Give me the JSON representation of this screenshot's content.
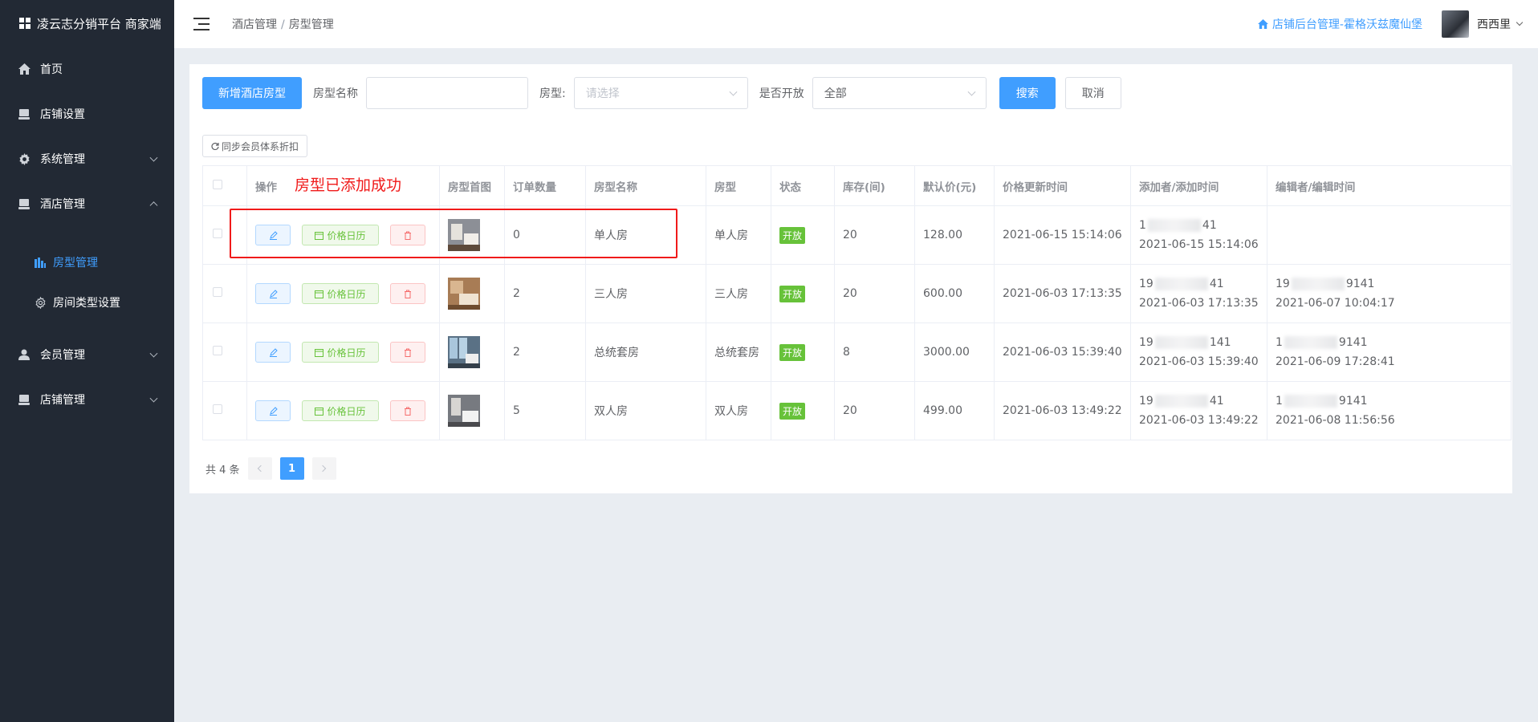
{
  "app": {
    "brand": "凌云志分销平台 商家端"
  },
  "sidebar": {
    "items": [
      {
        "label": "首页",
        "icon": "home-icon"
      },
      {
        "label": "店铺设置",
        "icon": "monitor-icon"
      },
      {
        "label": "系统管理",
        "icon": "gear-icon"
      },
      {
        "label": "酒店管理",
        "icon": "monitor-icon"
      },
      {
        "label": "会员管理",
        "icon": "user-icon"
      },
      {
        "label": "店铺管理",
        "icon": "monitor-icon"
      }
    ],
    "hotel_sub": [
      {
        "label": "房型管理",
        "icon": "bar-chart-icon",
        "active": true
      },
      {
        "label": "房间类型设置",
        "icon": "cog-icon"
      }
    ]
  },
  "header": {
    "breadcrumb": [
      "酒店管理",
      "房型管理"
    ],
    "breadcrumb_sep": "/",
    "store_link": "店铺后台管理-霍格沃兹魔仙堡",
    "username": "西西里"
  },
  "toolbar": {
    "add_label": "新增酒店房型",
    "room_name_label": "房型名称",
    "room_name_value": "",
    "room_type_label": "房型:",
    "room_type_placeholder": "请选择",
    "open_label": "是否开放",
    "open_value": "全部",
    "search_label": "搜索",
    "cancel_label": "取消",
    "sync_label": "同步会员体系折扣"
  },
  "table": {
    "headers": [
      "操作",
      "房型首图",
      "订单数量",
      "房型名称",
      "房型",
      "状态",
      "库存(间)",
      "默认价(元)",
      "价格更新时间",
      "添加者/添加时间",
      "编辑者/编辑时间"
    ],
    "price_calendar_label": "价格日历",
    "rows": [
      {
        "orders": "0",
        "name": "单人房",
        "type": "单人房",
        "status": "开放",
        "stock": "20",
        "price": "128.00",
        "updated": "2021-06-15 15:14:06",
        "adder_prefix": "1",
        "adder_suffix": "41",
        "added": "2021-06-15 15:14:06",
        "editor_prefix": "",
        "editor_suffix": "",
        "edited": ""
      },
      {
        "orders": "2",
        "name": "三人房",
        "type": "三人房",
        "status": "开放",
        "stock": "20",
        "price": "600.00",
        "updated": "2021-06-03 17:13:35",
        "adder_prefix": "19",
        "adder_suffix": "41",
        "added": "2021-06-03 17:13:35",
        "editor_prefix": "19",
        "editor_suffix": "9141",
        "edited": "2021-06-07 10:04:17"
      },
      {
        "orders": "2",
        "name": "总统套房",
        "type": "总统套房",
        "status": "开放",
        "stock": "8",
        "price": "3000.00",
        "updated": "2021-06-03 15:39:40",
        "adder_prefix": "19",
        "adder_suffix": "141",
        "added": "2021-06-03 15:39:40",
        "editor_prefix": "1",
        "editor_suffix": "9141",
        "edited": "2021-06-09 17:28:41"
      },
      {
        "orders": "5",
        "name": "双人房",
        "type": "双人房",
        "status": "开放",
        "stock": "20",
        "price": "499.00",
        "updated": "2021-06-03 13:49:22",
        "adder_prefix": "19",
        "adder_suffix": "41",
        "added": "2021-06-03 13:49:22",
        "editor_prefix": "1",
        "editor_suffix": "9141",
        "edited": "2021-06-08 11:56:56"
      }
    ]
  },
  "annotation": {
    "message": "房型已添加成功"
  },
  "pagination": {
    "total": "共 4 条",
    "current": "1"
  },
  "colors": {
    "primary": "#409eff",
    "success": "#67c23a",
    "danger": "#f56c6c",
    "sidebar_bg": "#222934",
    "annotation_red": "#f01a1a"
  }
}
